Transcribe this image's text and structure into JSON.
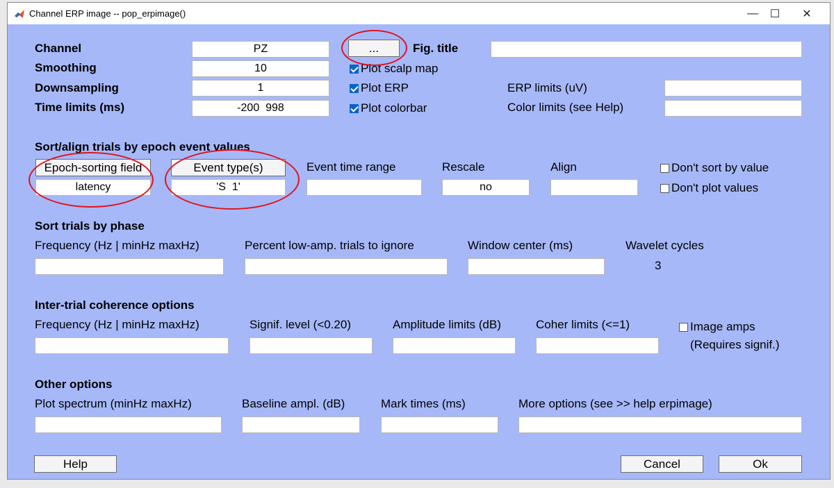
{
  "window": {
    "title": "Channel ERP image -- pop_erpimage()",
    "minimize_glyph": "—",
    "maximize_glyph": "☐",
    "close_glyph": "✕"
  },
  "basic": {
    "channel_label": "Channel",
    "channel_value": "PZ",
    "browse_label": "...",
    "fig_title_label": "Fig. title",
    "fig_title_value": "",
    "smoothing_label": "Smoothing",
    "smoothing_value": "10",
    "downsampling_label": "Downsampling",
    "downsampling_value": "1",
    "time_limits_label": "Time limits (ms)",
    "time_limits_value": "-200  998",
    "plot_scalp_map": {
      "label": "Plot scalp map",
      "checked": true
    },
    "plot_erp": {
      "label": "Plot ERP",
      "checked": true
    },
    "plot_colorbar": {
      "label": "Plot colorbar",
      "checked": true
    },
    "erp_limits_label": "ERP limits (uV)",
    "erp_limits_value": "",
    "color_limits_label": "Color limits (see Help)",
    "color_limits_value": ""
  },
  "sort_align": {
    "header": "Sort/align trials by epoch event values",
    "epoch_field_button": "Epoch-sorting field",
    "epoch_field_value": "latency",
    "event_type_button": "Event type(s)",
    "event_type_value": "'S  1'",
    "event_time_range_label": "Event time range",
    "event_time_range_value": "",
    "rescale_label": "Rescale",
    "rescale_value": "no",
    "align_label": "Align",
    "align_value": "",
    "dont_sort": {
      "label": "Don't sort by value",
      "checked": false
    },
    "dont_plot": {
      "label": "Don't plot values",
      "checked": false
    }
  },
  "phase": {
    "header": "Sort trials by phase",
    "frequency_label": "Frequency (Hz | minHz maxHz)",
    "frequency_value": "",
    "percent_label": "Percent low-amp. trials to ignore",
    "percent_value": "",
    "window_center_label": "Window center (ms)",
    "window_center_value": "",
    "wavelet_label": "Wavelet cycles",
    "wavelet_value": "3"
  },
  "itc": {
    "header": "Inter-trial coherence options",
    "frequency_label": "Frequency (Hz | minHz maxHz)",
    "frequency_value": "",
    "signif_label": "Signif. level (<0.20)",
    "signif_value": "",
    "amplitude_label": "Amplitude limits (dB)",
    "amplitude_value": "",
    "coher_label": "Coher limits (<=1)",
    "coher_value": "",
    "image_amps": {
      "label": "Image amps",
      "checked": false
    },
    "requires_note": "(Requires signif.)"
  },
  "other": {
    "header": "Other options",
    "spectrum_label": "Plot spectrum (minHz maxHz)",
    "spectrum_value": "",
    "baseline_label": "Baseline ampl. (dB)",
    "baseline_value": "",
    "mark_times_label": "Mark times (ms)",
    "mark_times_value": "",
    "more_options_label": "More options (see >> help erpimage)",
    "more_options_value": ""
  },
  "footer": {
    "help_label": "Help",
    "cancel_label": "Cancel",
    "ok_label": "Ok"
  },
  "colors": {
    "dialog_bg": "#a6b8f8",
    "annotation": "#e0141e",
    "checkbox_checked": "#0a64c8"
  }
}
